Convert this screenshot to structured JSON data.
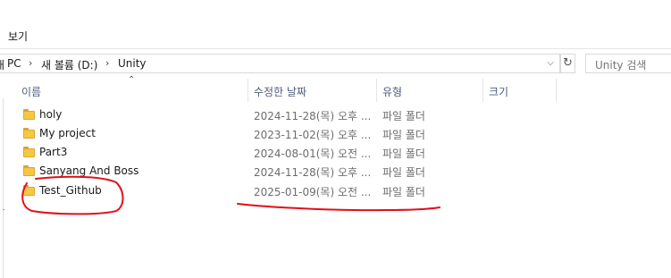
{
  "ribbon": {
    "view_tab": "보기"
  },
  "address": {
    "crumbs": [
      "PC",
      "새 볼륨 (D:)",
      "Unity"
    ],
    "prefix_char": "내"
  },
  "search": {
    "placeholder": "Unity 검색"
  },
  "columns": {
    "name": "이름",
    "date": "수정한 날짜",
    "type": "유형",
    "size": "크기"
  },
  "rows": [
    {
      "name": "holy",
      "date": "2024-11-28(목) 오후 ...",
      "type": "파일 폴더"
    },
    {
      "name": "My project",
      "date": "2023-11-02(목) 오후 ...",
      "type": "파일 폴더"
    },
    {
      "name": "Part3",
      "date": "2024-08-01(목) 오전 ...",
      "type": "파일 폴더"
    },
    {
      "name": "Sanyang And Boss",
      "date": "2024-11-28(목) 오후 ...",
      "type": "파일 폴더"
    },
    {
      "name": "Test_Github",
      "date": "2025-01-09(목) 오전 ...",
      "type": "파일 폴더"
    }
  ],
  "colors": {
    "annotation": "#e0101a",
    "folder": "#f6c744",
    "header_text": "#4d5d7a"
  }
}
